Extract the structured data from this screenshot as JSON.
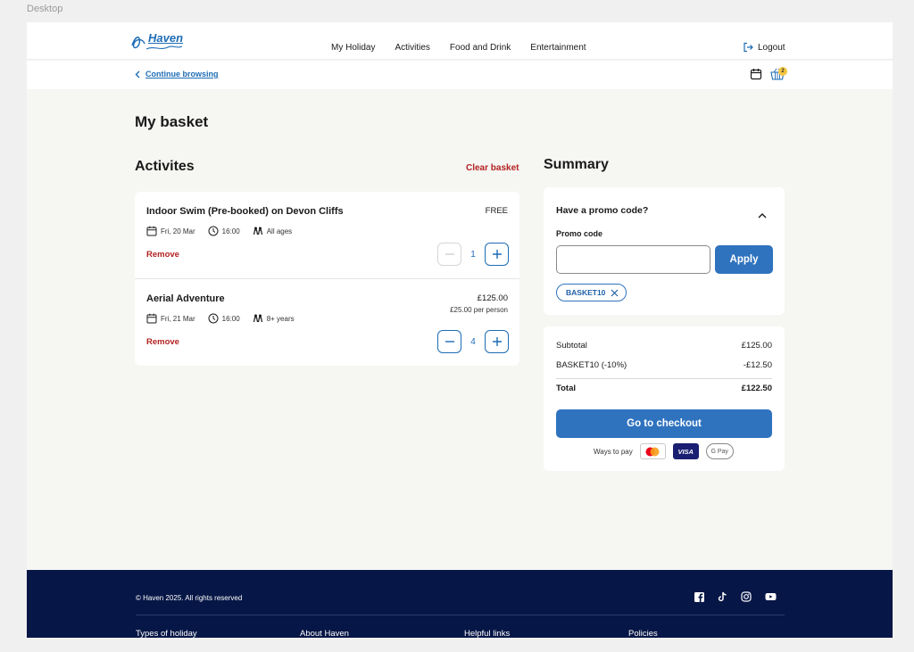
{
  "window": {
    "label": "Desktop"
  },
  "header": {
    "logo_text": "Haven",
    "nav": [
      "My Holiday",
      "Activities",
      "Food and Drink",
      "Entertainment"
    ],
    "logout_label": "Logout"
  },
  "subbar": {
    "continue_label": "Continue browsing",
    "basket_count": "2"
  },
  "page": {
    "title": "My basket",
    "section_title": "Activites",
    "clear_label": "Clear basket"
  },
  "items": [
    {
      "name": "Indoor Swim (Pre-booked) on Devon Cliffs",
      "price": "FREE",
      "per_person": "",
      "date": "Fri, 20 Mar",
      "time": "16:00",
      "ages": "All ages",
      "remove_label": "Remove",
      "quantity": "1"
    },
    {
      "name": "Aerial Adventure",
      "price": "£125.00",
      "per_person": "£25.00 per person",
      "date": "Fri, 21 Mar",
      "time": "16:00",
      "ages": "8+ years",
      "remove_label": "Remove",
      "quantity": "4"
    }
  ],
  "summary": {
    "title": "Summary",
    "promo_question": "Have a promo code?",
    "promo_label": "Promo code",
    "promo_value": "",
    "apply_label": "Apply",
    "applied_code": "BASKET10",
    "subtotal_label": "Subtotal",
    "subtotal_value": "£125.00",
    "discount_label": "BASKET10 (-10%)",
    "discount_value": "-£12.50",
    "total_label": "Total",
    "total_value": "£122.50",
    "checkout_label": "Go to checkout",
    "ways_label": "Ways to pay",
    "visa_label": "VISA",
    "gpay_label": "G Pay"
  },
  "footer": {
    "copyright": "© Haven 2025. All rights reserved",
    "columns": [
      "Types of holiday",
      "About Haven",
      "Helpful links",
      "Policies"
    ]
  },
  "colors": {
    "brand_blue": "#2f73bf",
    "remove_red": "#b32222",
    "footer_navy": "#061646",
    "badge_yellow": "#f5c842"
  },
  "icons": [
    "haven-logo",
    "logout-icon",
    "chevron-left-icon",
    "calendar-icon",
    "basket-icon",
    "clock-icon",
    "people-icon",
    "minus-icon",
    "plus-icon",
    "chevron-up-icon",
    "close-icon",
    "mastercard-icon",
    "facebook-icon",
    "tiktok-icon",
    "instagram-icon",
    "youtube-icon"
  ]
}
